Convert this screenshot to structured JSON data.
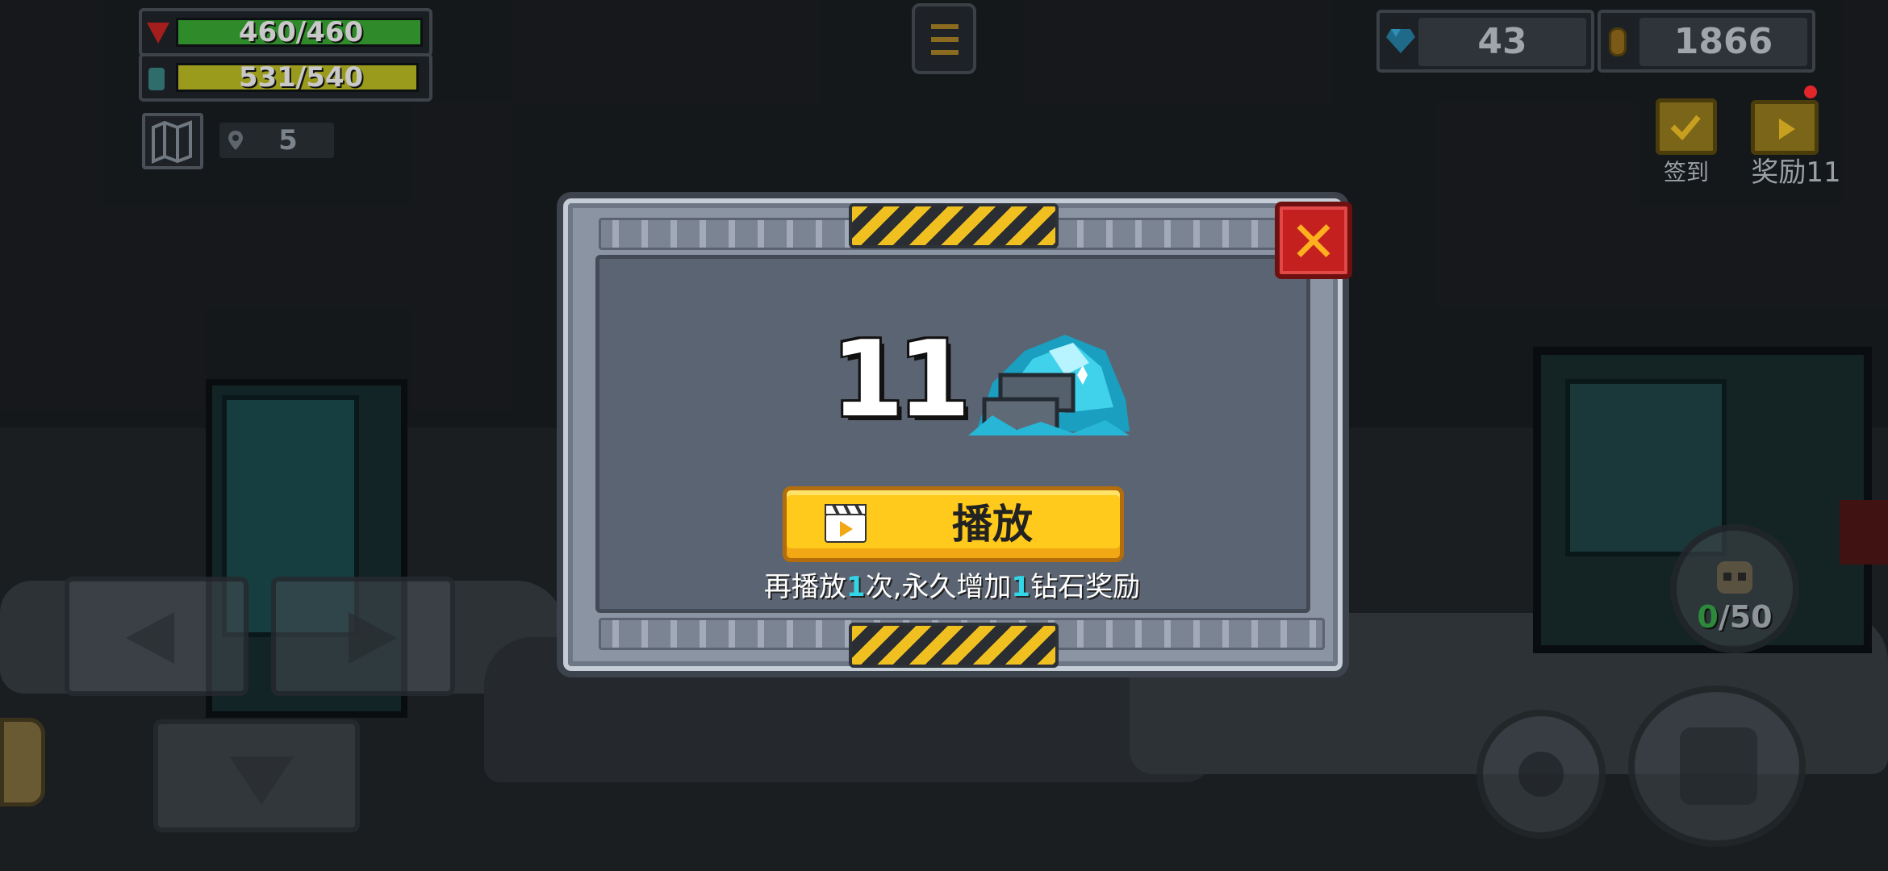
{
  "hud": {
    "hp_text": "460/460",
    "hp_ratio": 1.0,
    "energy_text": "531/540",
    "energy_ratio": 0.983,
    "map_level": "5",
    "diamonds": "43",
    "coins": "1866",
    "colors": {
      "hp": "#2f8a2a",
      "energy": "#9a9a1c",
      "accent": "#f0c020",
      "diamond": "#32d6e6"
    }
  },
  "menu": {
    "icon": "hamburger-icon"
  },
  "side_buttons": {
    "checkin_label": "签到",
    "reward_label": "奖励11"
  },
  "ammo": {
    "current": "0",
    "separator_max": "/50"
  },
  "dialog": {
    "reward_amount": "11",
    "reward_icon": "diamond-pile-icon",
    "play_label": "播放",
    "hint_parts": [
      "再播放",
      "1",
      "次,永久增加",
      "1",
      "钻石奖励"
    ],
    "close_icon": "close-icon"
  }
}
